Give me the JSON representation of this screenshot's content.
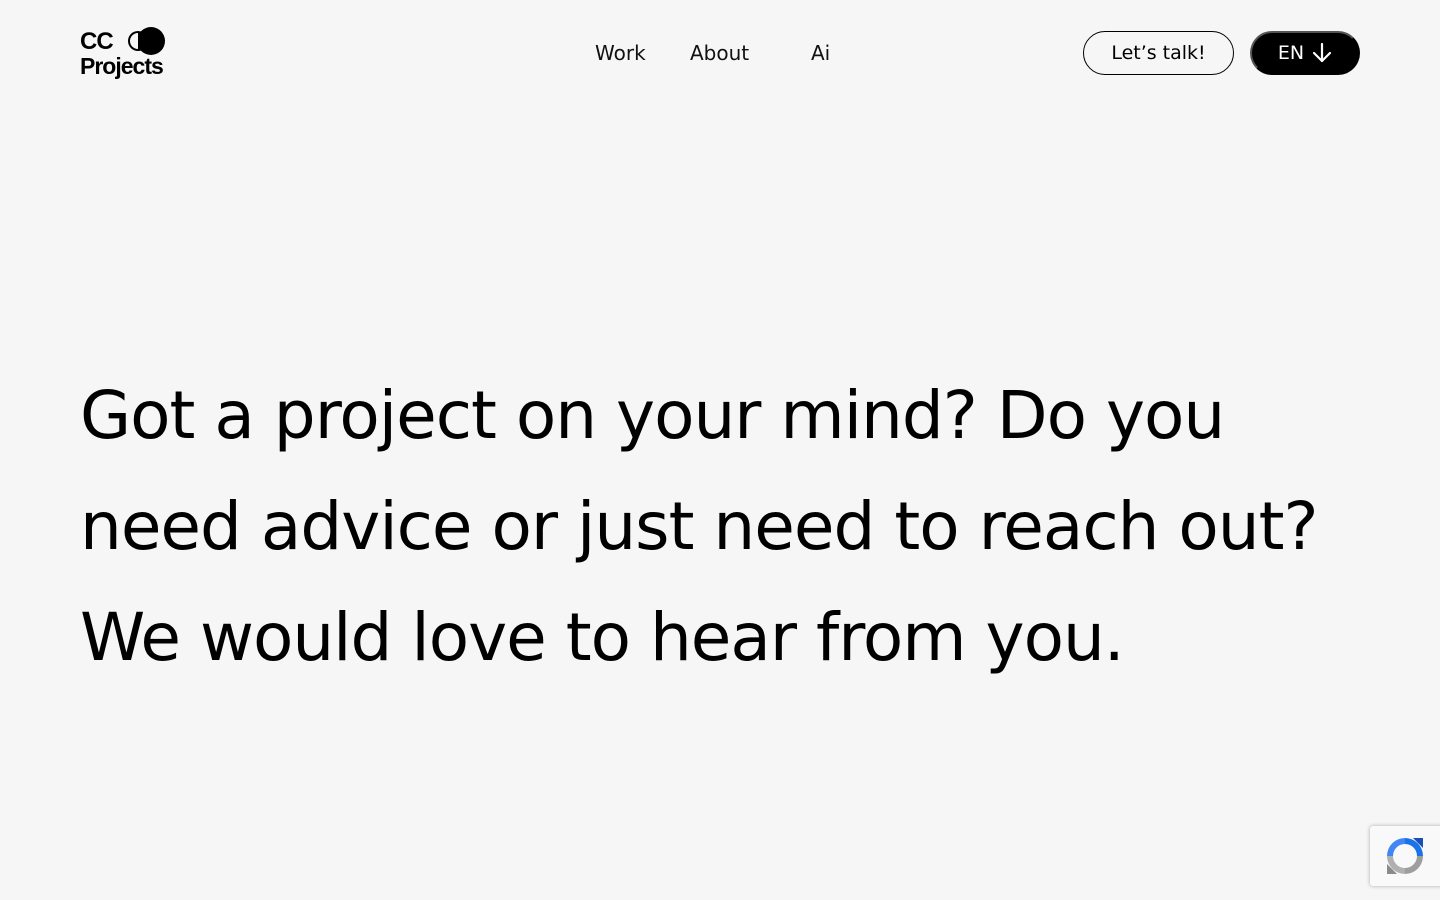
{
  "brand": {
    "logo_line1": "CC",
    "logo_line2": "Projects"
  },
  "nav": {
    "items": [
      {
        "label": "Work"
      },
      {
        "label": "About"
      },
      {
        "label": "Ai"
      }
    ]
  },
  "actions": {
    "talk_label": "Let’s talk!",
    "language_label": "EN"
  },
  "hero": {
    "headline": "Got a project on your mind? Do you need advice or just need to reach out? We would love to hear from you."
  },
  "icons": {
    "language_arrow": "arrow-down-icon",
    "recaptcha": "recaptcha-icon"
  },
  "colors": {
    "background": "#f6f6f6",
    "text": "#000000",
    "button_dark": "#000000",
    "button_dark_text": "#ffffff",
    "recaptcha_blue": "#1a73e8",
    "recaptcha_gray": "#9e9e9e"
  }
}
